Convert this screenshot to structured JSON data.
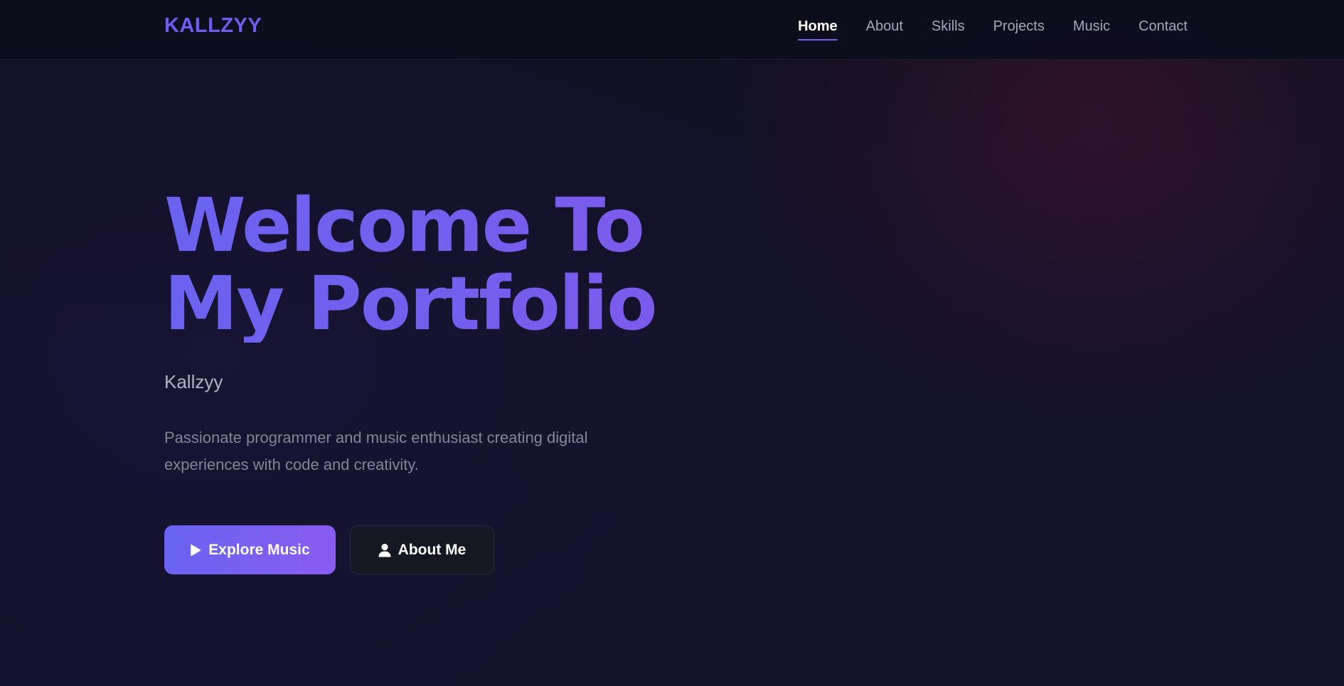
{
  "header": {
    "brand": "KALLZYY",
    "nav": [
      {
        "label": "Home",
        "active": true
      },
      {
        "label": "About",
        "active": false
      },
      {
        "label": "Skills",
        "active": false
      },
      {
        "label": "Projects",
        "active": false
      },
      {
        "label": "Music",
        "active": false
      },
      {
        "label": "Contact",
        "active": false
      }
    ]
  },
  "hero": {
    "title_line1": "Welcome To",
    "title_line2": "My Portfolio",
    "subtitle": "Kallzyy",
    "description": "Passionate programmer and music enthusiast creating digital experiences with code and creativity.",
    "primary_button": {
      "label": "Explore Music",
      "icon": "play-icon"
    },
    "secondary_button": {
      "label": "About Me",
      "icon": "user-icon"
    }
  },
  "colors": {
    "accent": "#6d5cf0",
    "accent_end": "#8a5cf0",
    "background": "#13122b"
  }
}
